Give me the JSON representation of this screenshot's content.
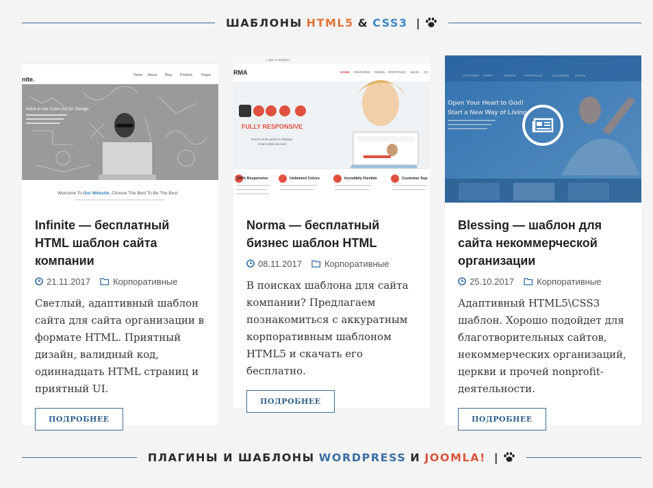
{
  "heading_top": {
    "part1": "ШАБЛОНЫ",
    "part2": "HTML5",
    "part3": "&",
    "part4": "CSS3",
    "pipe": "|"
  },
  "heading_bottom": {
    "part1": "ПЛАГИНЫ И ШАБЛОНЫ",
    "part2": "WORDPRESS",
    "part3": "И",
    "part4": "JOOMLA!",
    "pipe": "|"
  },
  "cards": [
    {
      "title": "Infinite — бесплатный HTML шаблон сайта компании",
      "date": "21.11.2017",
      "category": "Корпоративные",
      "description": "Светлый, адаптивный шаблон сайта для сайта организации в формате HTML. Приятный дизайн, валидный код, одиннадцать HTML страниц и приятный UI.",
      "button": "ПОДРОБНЕЕ",
      "thumb": {
        "logo": "nite.",
        "menu": [
          "Home",
          "About",
          "Blog",
          "Portfolio",
          "Pages"
        ],
        "hero_text": "Artist in me Cries out for Design",
        "welcome_a": "Welcome To",
        "welcome_b": "Our Website",
        "welcome_c": ", Choose The Best To Be The Best"
      }
    },
    {
      "title": "Norma — бесплатный бизнес шаблон HTML",
      "date": "08.11.2017",
      "category": "Корпоративные",
      "description": "В поисках шаблона для сайта компании? Предлагаем познакомиться с аккуратным корпоративным шаблоном HTML5 и скачать его бесплатно.",
      "button": "ПОДРОБНЕЕ",
      "thumb": {
        "logo": "RMA",
        "login": "Login or Register",
        "menu": [
          "HOME",
          "FEATURES",
          "PAGES",
          "PORTFOLIO",
          "BLOG",
          "CO"
        ],
        "hero": "FULLY RESPONSIVE",
        "sub": "Norma looks great on displays of all mobile devices!",
        "features": [
          "100% Responsive",
          "Unlimited Colors",
          "Incredibly Flexible",
          "Customer Sup"
        ]
      }
    },
    {
      "title": "Blessing — шаблон для сайта некоммерческой организации",
      "date": "25.10.2017",
      "category": "Корпоративные",
      "description": "Адаптивный HTML5\\CSS3 шаблон. Хорошо подойдет для благотворительных сайтов, некоммерческих организаций, церкви и прочей nonprofit-деятельности.",
      "button": "ПОДРОБНЕЕ",
      "thumb": {
        "headline1": "Open Your Heart to God!",
        "headline2": "Start a New Way of Living"
      }
    }
  ],
  "colors": {
    "accent_orange": "#e0743a",
    "accent_blue": "#3d86c6",
    "accent_red": "#d8553c",
    "wordpress_blue": "#3a6fa1",
    "button_border": "#3a6a92"
  }
}
